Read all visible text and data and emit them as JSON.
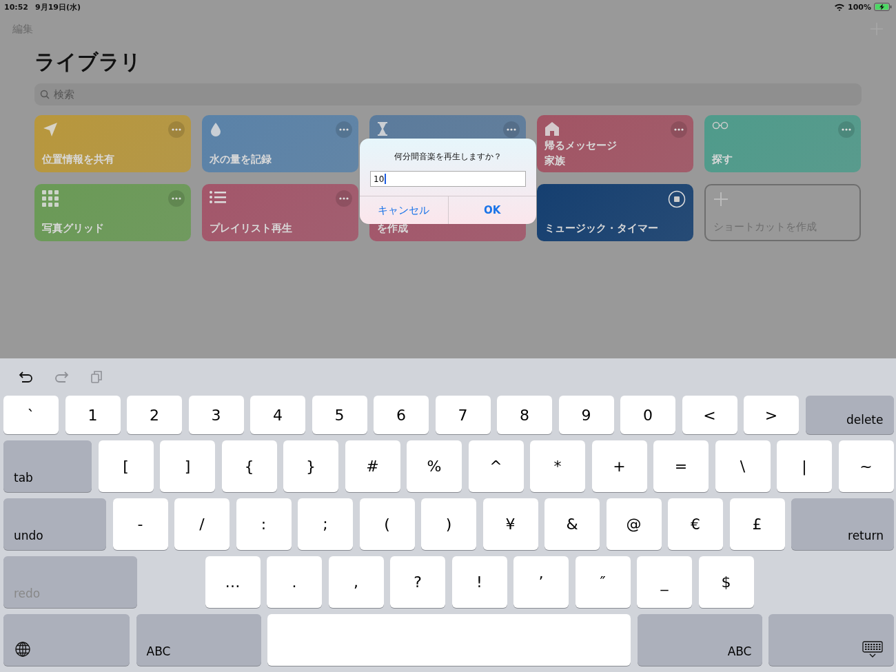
{
  "status_bar": {
    "time": "10:52",
    "date": "9月19日(水)",
    "battery": "100%"
  },
  "nav": {
    "edit": "編集"
  },
  "title": "ライブラリ",
  "search": {
    "placeholder": "検索"
  },
  "shortcuts": [
    {
      "kind": "shortcut",
      "lines": [
        "位置情報を共有"
      ],
      "color": "#b8973c"
    },
    {
      "kind": "shortcut",
      "lines": [
        "水の量を記録"
      ],
      "color": "#5a82a8"
    },
    {
      "kind": "shortcut",
      "color": "#5b7b9c"
    },
    {
      "kind": "shortcut",
      "lines": [
        "帰るメッセージ",
        "家族"
      ],
      "color": "#a25464"
    },
    {
      "kind": "shortcut",
      "lines": [
        "探す"
      ],
      "color": "#4f9b8b"
    },
    {
      "kind": "shortcut",
      "lines": [
        "写真グリッド"
      ],
      "color": "#6a9a56"
    },
    {
      "kind": "shortcut",
      "lines": [
        "プレイリスト再生"
      ],
      "color": "#a3566a"
    },
    {
      "kind": "covered",
      "lines": [
        "を作成"
      ],
      "color": "#a3566a"
    },
    {
      "kind": "running",
      "lines": [
        "ミュージック・タイマー"
      ],
      "color": "#153f70"
    },
    {
      "kind": "create",
      "lines": [
        "ショートカットを作成"
      ],
      "color": "#6e6e6e"
    }
  ],
  "dialog": {
    "message": "何分間音楽を再生しますか？",
    "value": "10",
    "buttons": [
      "キャンセル",
      "OK"
    ]
  },
  "keyboard": {
    "toolbar": [
      {
        "kind": "undo",
        "disabled": false
      },
      {
        "kind": "redo",
        "disabled": true
      },
      {
        "kind": "paste",
        "disabled": true
      }
    ],
    "rows": [
      {
        "keys": [
          {
            "kind": "char",
            "label": "`"
          },
          {
            "kind": "char",
            "label": "1"
          },
          {
            "kind": "char",
            "label": "2"
          },
          {
            "kind": "char",
            "label": "3"
          },
          {
            "kind": "char",
            "label": "4"
          },
          {
            "kind": "char",
            "label": "5"
          },
          {
            "kind": "char",
            "label": "6"
          },
          {
            "kind": "char",
            "label": "7"
          },
          {
            "kind": "char",
            "label": "8"
          },
          {
            "kind": "char",
            "label": "9"
          },
          {
            "kind": "char",
            "label": "0"
          },
          {
            "kind": "char",
            "label": "<"
          },
          {
            "kind": "char",
            "label": ">"
          },
          {
            "kind": "mod",
            "label": "delete",
            "disabled": false
          }
        ]
      },
      {
        "keys": [
          {
            "kind": "mod",
            "label": "tab",
            "disabled": false
          },
          {
            "kind": "char",
            "label": "["
          },
          {
            "kind": "char",
            "label": "]"
          },
          {
            "kind": "char",
            "label": "{"
          },
          {
            "kind": "char",
            "label": "}"
          },
          {
            "kind": "char",
            "label": "#"
          },
          {
            "kind": "char",
            "label": "%"
          },
          {
            "kind": "char",
            "label": "^"
          },
          {
            "kind": "char",
            "label": "*"
          },
          {
            "kind": "char",
            "label": "+"
          },
          {
            "kind": "char",
            "label": "="
          },
          {
            "kind": "char",
            "label": "\\"
          },
          {
            "kind": "char",
            "label": "|"
          },
          {
            "kind": "char",
            "label": "~"
          }
        ]
      },
      {
        "keys": [
          {
            "kind": "mod",
            "label": "undo",
            "disabled": false
          },
          {
            "kind": "char",
            "label": "-"
          },
          {
            "kind": "char",
            "label": "/"
          },
          {
            "kind": "char",
            "label": ":"
          },
          {
            "kind": "char",
            "label": ";"
          },
          {
            "kind": "char",
            "label": "("
          },
          {
            "kind": "char",
            "label": ")"
          },
          {
            "kind": "char",
            "label": "¥"
          },
          {
            "kind": "char",
            "label": "&"
          },
          {
            "kind": "char",
            "label": "@"
          },
          {
            "kind": "char",
            "label": "€"
          },
          {
            "kind": "char",
            "label": "£"
          },
          {
            "kind": "mod",
            "label": "return",
            "disabled": false
          }
        ]
      },
      {
        "keys": [
          {
            "kind": "mod",
            "label": "redo",
            "disabled": true
          },
          {
            "kind": "char",
            "label": "…"
          },
          {
            "kind": "char",
            "label": "."
          },
          {
            "kind": "char",
            "label": ","
          },
          {
            "kind": "char",
            "label": "?"
          },
          {
            "kind": "char",
            "label": "!"
          },
          {
            "kind": "char",
            "label": "’"
          },
          {
            "kind": "char",
            "label": "″"
          },
          {
            "kind": "char",
            "label": "_"
          },
          {
            "kind": "char",
            "label": "$"
          }
        ]
      },
      {
        "keys": [
          {
            "kind": "globe"
          },
          {
            "kind": "mod",
            "label": "ABC",
            "disabled": false
          },
          {
            "kind": "space"
          },
          {
            "kind": "mod",
            "label": "ABC",
            "disabled": false
          },
          {
            "kind": "hide"
          }
        ]
      }
    ]
  }
}
